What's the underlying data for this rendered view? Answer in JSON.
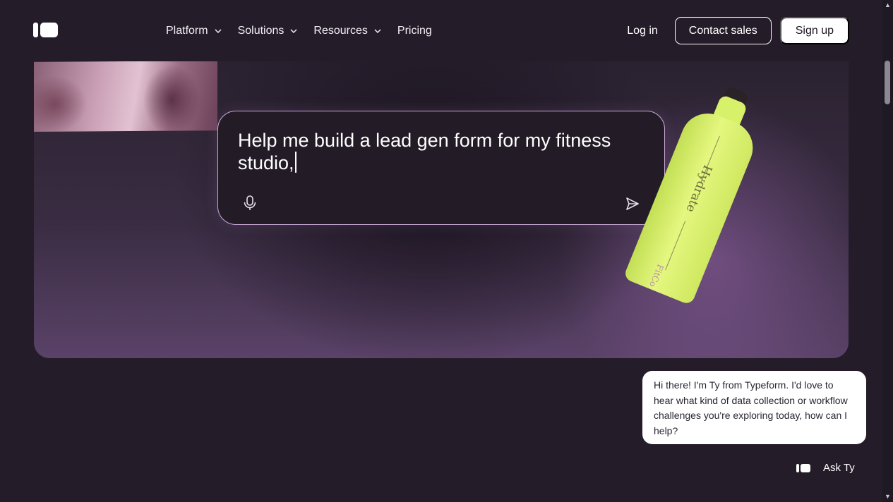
{
  "header": {
    "logo_icon": "typeform-logo-icon",
    "nav": [
      {
        "label": "Platform",
        "has_dropdown": true
      },
      {
        "label": "Solutions",
        "has_dropdown": true
      },
      {
        "label": "Resources",
        "has_dropdown": true
      },
      {
        "label": "Pricing",
        "has_dropdown": false
      }
    ],
    "login_label": "Log in",
    "contact_label": "Contact sales",
    "signup_label": "Sign up"
  },
  "hero": {
    "prompt_text": "Help me build a lead gen form for my fitness studio,",
    "mic_icon": "microphone-icon",
    "send_icon": "send-icon",
    "bottle": {
      "brand_word": "Hydrate",
      "maker": "FitCo"
    }
  },
  "chat": {
    "message": "Hi there! I'm Ty from Typeform. I'd love to hear what kind of data collection or workflow challenges you're exploring today, how can I help?",
    "ask_label": "Ask Ty"
  },
  "colors": {
    "background": "#241d29",
    "bottle": "#d8f16a",
    "prompt_border": "#c9a8d6"
  }
}
